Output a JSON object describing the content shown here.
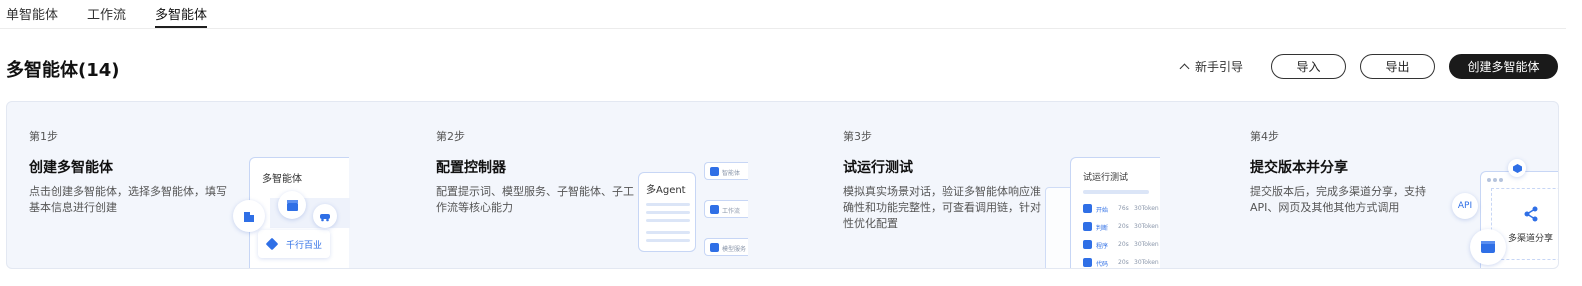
{
  "tabs": [
    {
      "label": "单智能体",
      "active": false
    },
    {
      "label": "工作流",
      "active": false
    },
    {
      "label": "多智能体",
      "active": true
    }
  ],
  "header": {
    "title": "多智能体",
    "count": "(14)"
  },
  "actions": {
    "guide_label": "新手引导",
    "import_label": "导入",
    "export_label": "导出",
    "create_label": "创建多智能体"
  },
  "steps": [
    {
      "num": "第1步",
      "title": "创建多智能体",
      "desc": "点击创建多智能体，选择多智能体，填写基本信息进行创建",
      "illustration": {
        "card_title": "多智能体",
        "chip_label": "千行百业"
      }
    },
    {
      "num": "第2步",
      "title": "配置控制器",
      "desc": "配置提示词、模型服务、子智能体、子工作流等核心能力",
      "illustration": {
        "agent_label": "多Agent",
        "items": [
          "智能体",
          "工作流",
          "模型服务"
        ]
      }
    },
    {
      "num": "第3步",
      "title": "试运行测试",
      "desc": "模拟真实场景对话，验证多智能体响应准确性和功能完整性，可查看调用链，针对性优化配置",
      "illustration": {
        "card_title": "试运行测试",
        "rows": [
          {
            "name": "开始",
            "t": "76s",
            "tokens": "30Token"
          },
          {
            "name": "判断",
            "t": "20s",
            "tokens": "30Token"
          },
          {
            "name": "程序",
            "t": "20s",
            "tokens": "30Token"
          },
          {
            "name": "代码",
            "t": "20s",
            "tokens": "30Token"
          }
        ]
      }
    },
    {
      "num": "第4步",
      "title": "提交版本并分享",
      "desc": "提交版本后，完成多渠道分享，支持API、网页及其他其他方式调用",
      "illustration": {
        "api_label": "API",
        "share_label": "多渠道分享"
      }
    }
  ],
  "colors": {
    "accent": "#2f6fe6",
    "panel_bg": "#f3f6fc",
    "primary_button": "#1a1a1a"
  }
}
